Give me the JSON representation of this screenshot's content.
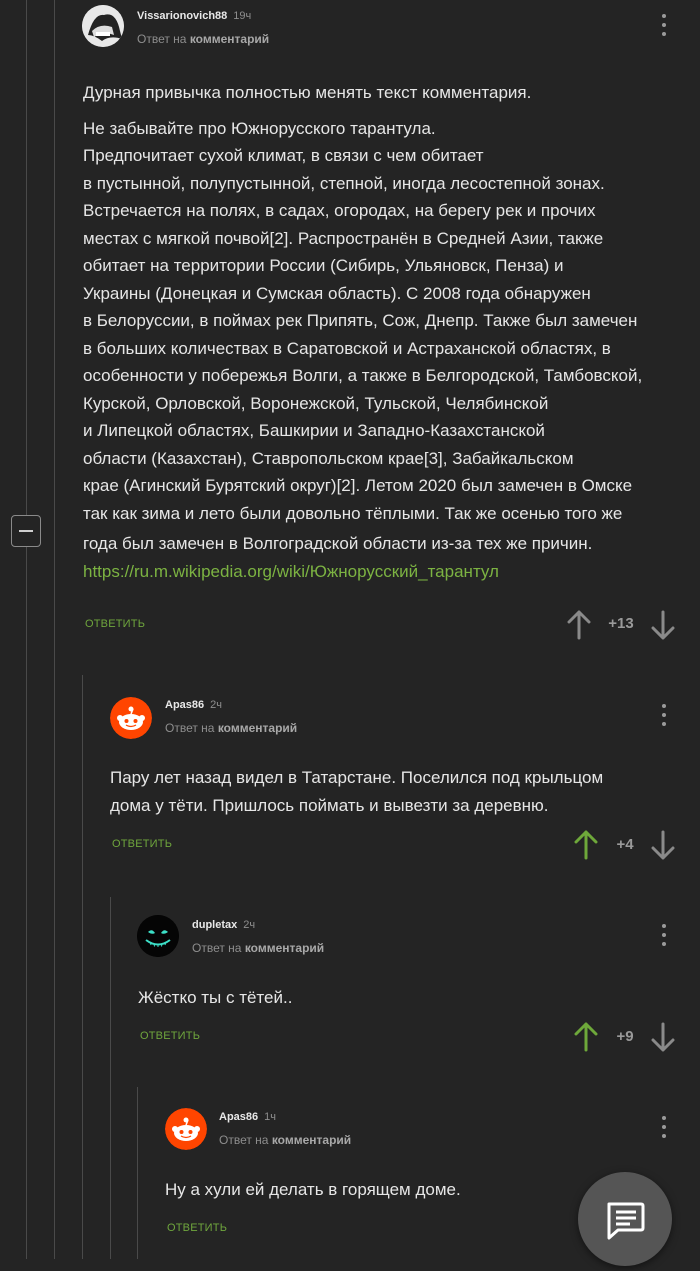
{
  "comments": [
    {
      "author": "Vissarionovich88",
      "time": "19ч",
      "reply_prefix": "Ответ на",
      "reply_target": "комментарий",
      "paragraphs": [
        "Дурная привычка полностью менять текст комментария.",
        " Не забывайте про Южнорусского тарантула.",
        "Предпочитает сухой климат, в связи с чем обитает",
        "в пустынной, полупустынной, степной, иногда лесостепной зонах.",
        "Встречается на полях, в садах, огородах, на берегу рек и прочих",
        "местах с мягкой почвой[2]. Распространён в Средней Азии, также",
        "обитает на территории России (Сибирь, Ульяновск, Пенза) и",
        "Украины (Донецкая и Сумская область). С 2008 года обнаружен",
        "в Белоруссии, в поймах рек Припять, Сож, Днепр. Также был замечен",
        "в больших количествах в Саратовской и Астраханской областях, в",
        "особенности у побережья Волги, а также в Белгородской, Тамбовской,",
        "Курской, Орловской, Воронежской, Тульской, Челябинской",
        "и Липецкой областях, Башкирии и Западно-Казахстанской",
        "области (Казахстан), Ставропольском крае[3], Забайкальском",
        "крае (Агинский Бурятский округ)[2]. Летом 2020 был замечен в Омске",
        "так как зима и лето были довольно тёплыми. Так же осенью того же",
        "года был замечен в Волгоградской области из-за тех же причин."
      ],
      "link": "https://ru.m.wikipedia.org/wiki/Южнорусский_тарантул",
      "reply_label": "ОТВЕТИТЬ",
      "score": "+13"
    },
    {
      "author": "Apas86",
      "time": "2ч",
      "reply_prefix": "Ответ на",
      "reply_target": "комментарий",
      "paragraphs": [
        "Пару лет назад видел в Татарстане. Поселился под крыльцом",
        "дома у тёти. Пришлось поймать и вывезти за деревню."
      ],
      "reply_label": "ОТВЕТИТЬ",
      "score": "+4"
    },
    {
      "author": "dupletax",
      "time": "2ч",
      "reply_prefix": "Ответ на",
      "reply_target": "комментарий",
      "paragraphs": [
        "Жёстко ты с тётей.."
      ],
      "reply_label": "ОТВЕТИТЬ",
      "score": "+9"
    },
    {
      "author": "Apas86",
      "time": "1ч",
      "reply_prefix": "Ответ на",
      "reply_target": "комментарий",
      "paragraphs": [
        "Ну а хули ей делать в горящем доме."
      ],
      "reply_label": "ОТВЕТИТЬ"
    }
  ],
  "icons": {
    "upvote_active": "#6ea83a",
    "upvote_inactive": "#8a8a8a",
    "downvote": "#8a8a8a",
    "fab": "chat-icon"
  }
}
